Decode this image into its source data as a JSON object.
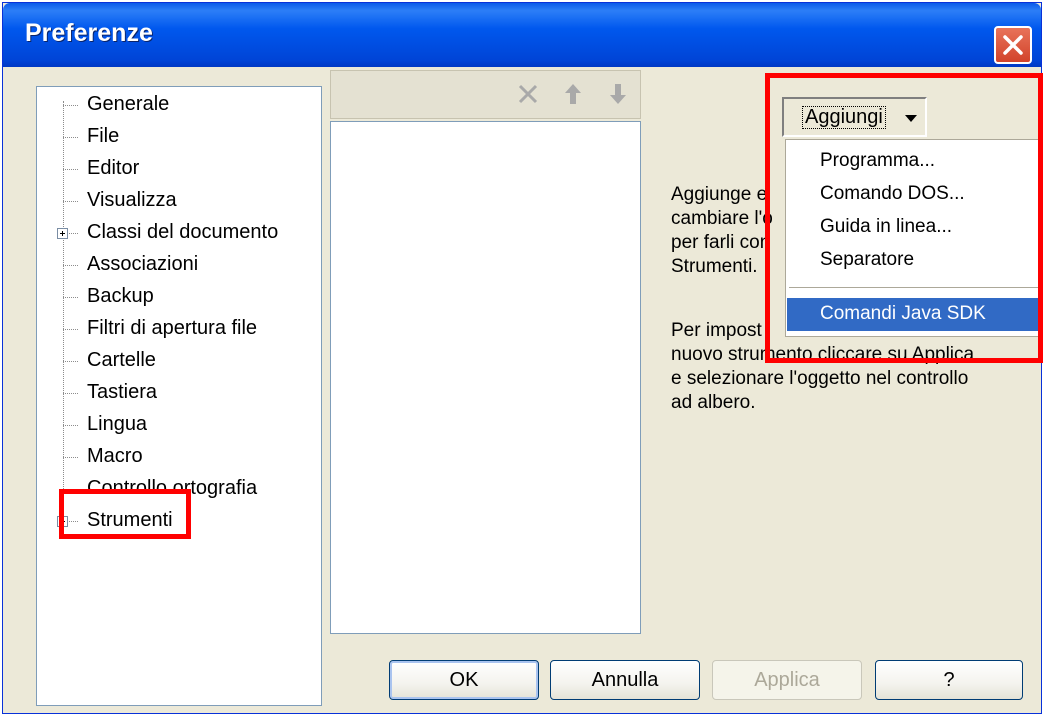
{
  "window": {
    "title": "Preferenze"
  },
  "tree": {
    "items": [
      {
        "label": "Generale",
        "expander": false
      },
      {
        "label": "File",
        "expander": false
      },
      {
        "label": "Editor",
        "expander": false
      },
      {
        "label": "Visualizza",
        "expander": false
      },
      {
        "label": "Classi del documento",
        "expander": true
      },
      {
        "label": "Associazioni",
        "expander": false
      },
      {
        "label": "Backup",
        "expander": false
      },
      {
        "label": "Filtri di apertura file",
        "expander": false
      },
      {
        "label": "Cartelle",
        "expander": false
      },
      {
        "label": "Tastiera",
        "expander": false
      },
      {
        "label": "Lingua",
        "expander": false
      },
      {
        "label": "Macro",
        "expander": false
      },
      {
        "label": "Controllo ortografia",
        "expander": false
      },
      {
        "label": "Strumenti",
        "expander": true
      }
    ]
  },
  "toolbar": {
    "icons": [
      "delete-icon",
      "move-up-icon",
      "move-down-icon"
    ]
  },
  "add_button": {
    "label": "Aggiungi"
  },
  "description": {
    "para1": [
      "Aggiunge e",
      "cambiare l'o",
      "per farli con",
      "Strumenti."
    ],
    "para2": [
      "Per impost",
      "nuovo strumento cliccare su Applica",
      "e selezionare l'oggetto nel controllo",
      "ad albero."
    ]
  },
  "menu": {
    "items": [
      "Programma...",
      "Comando DOS...",
      "Guida in linea...",
      "Separatore"
    ],
    "selected_item": "Comandi Java SDK"
  },
  "buttons": {
    "ok": "OK",
    "cancel": "Annulla",
    "apply": "Applica",
    "help": "?"
  },
  "colors": {
    "highlight": "#ff0000",
    "titlebar": "#0054e3",
    "selection": "#316ac5",
    "dialog_bg": "#ece9d8"
  }
}
